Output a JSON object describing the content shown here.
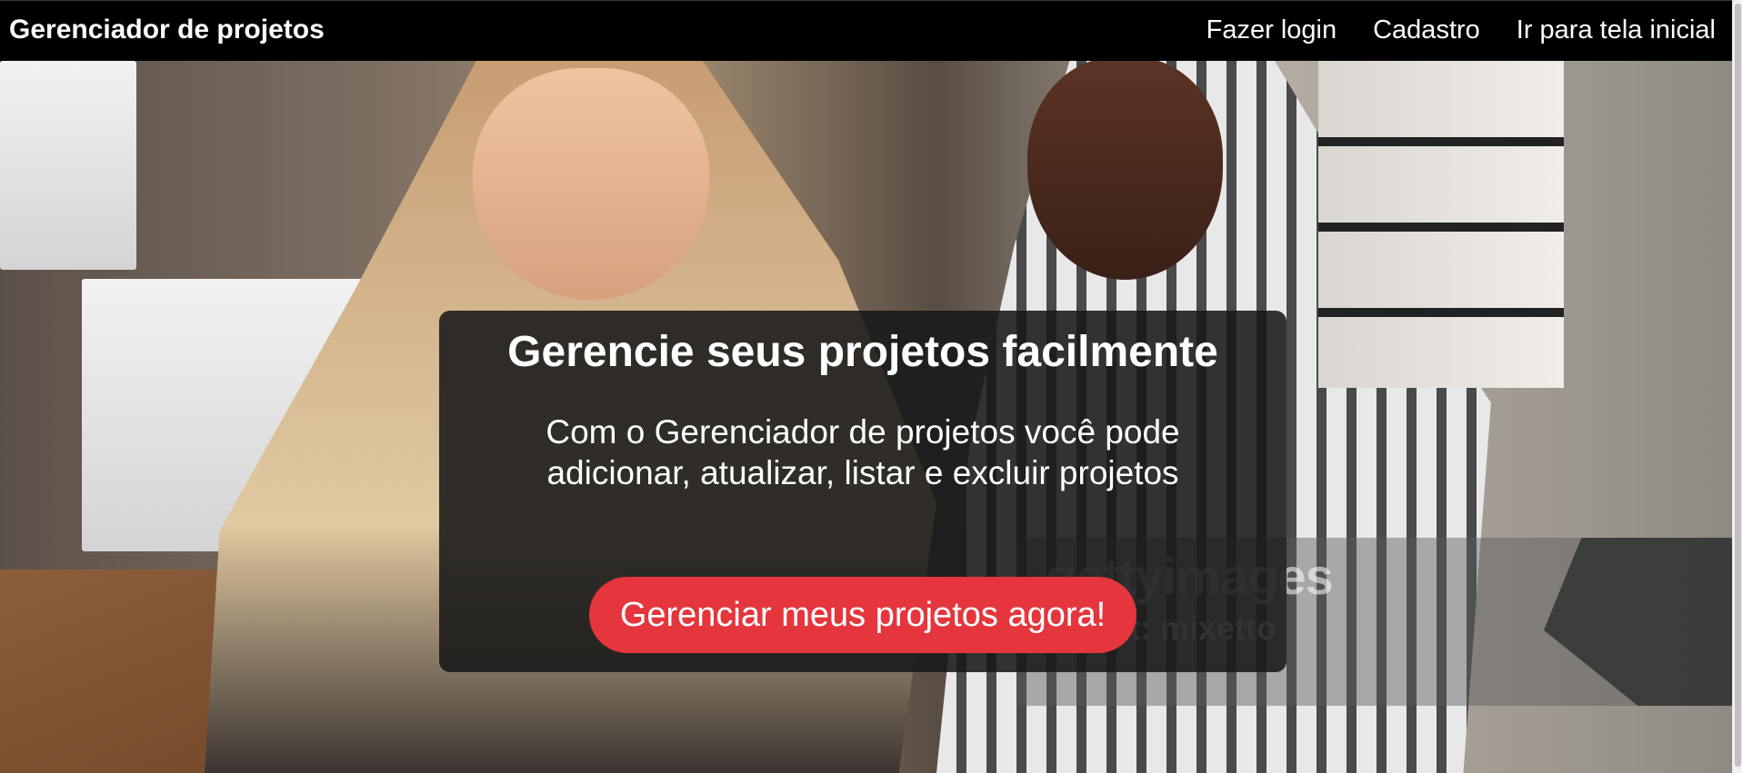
{
  "navbar": {
    "brand": "Gerenciador de projetos",
    "links": [
      "Fazer login",
      "Cadastro",
      "Ir para tela inicial"
    ]
  },
  "hero": {
    "headline": "Gerencie seus projetos facilmente",
    "description": "Com o Gerenciador de projetos você pode adicionar, atualizar, listar e excluir projetos",
    "button_label": "Gerenciar meus projetos agora!",
    "watermark": {
      "logo": "gettyimages",
      "credit": "Credit: mixetto"
    }
  },
  "colors": {
    "navbar": "#000000",
    "overlay": "#181818",
    "button": "#e4363c",
    "text": "#ffffff"
  }
}
